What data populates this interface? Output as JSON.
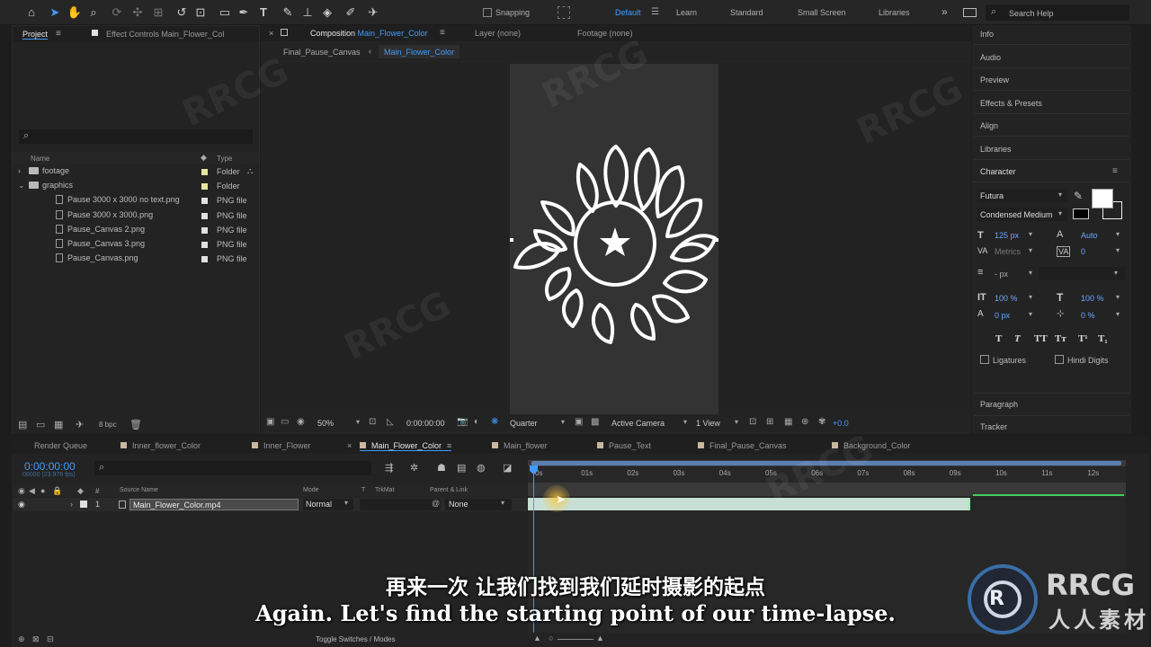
{
  "toolbar": {
    "snapping_label": "Snapping",
    "workspaces": [
      "Default",
      "Learn",
      "Standard",
      "Small Screen",
      "Libraries"
    ],
    "active_workspace": "Default",
    "search_placeholder": "Search Help",
    "tool_icons": [
      "home-icon",
      "selection-icon",
      "hand-icon",
      "zoom-icon",
      "rotate-icon",
      "camera-orbit-icon",
      "pan-behind-icon",
      "rectangle-icon",
      "pen-icon",
      "type-icon",
      "brush-icon",
      "clone-stamp-icon",
      "eraser-icon",
      "roto-brush-icon",
      "puppet-icon"
    ]
  },
  "project_panel": {
    "tab_label": "Project",
    "effect_controls_tab": "Effect Controls Main_Flower_Col",
    "col_name": "Name",
    "col_type": "Type",
    "items": [
      {
        "name": "footage",
        "type": "Folder",
        "kind": "folder",
        "color": "#e6e6a0"
      },
      {
        "name": "graphics",
        "type": "Folder",
        "kind": "folder",
        "color": "#e6e6a0"
      },
      {
        "name": "Pause 3000 x 3000 no text.png",
        "type": "PNG file",
        "kind": "file",
        "color": "#e0e0e0"
      },
      {
        "name": "Pause 3000 x 3000.png",
        "type": "PNG file",
        "kind": "file",
        "color": "#e0e0e0"
      },
      {
        "name": "Pause_Canvas 2.png",
        "type": "PNG file",
        "kind": "file",
        "color": "#e0e0e0"
      },
      {
        "name": "Pause_Canvas 3.png",
        "type": "PNG file",
        "kind": "file",
        "color": "#e0e0e0"
      },
      {
        "name": "Pause_Canvas.png",
        "type": "PNG file",
        "kind": "file",
        "color": "#e0e0e0"
      }
    ],
    "bpc": "8 bpc"
  },
  "composition_panel": {
    "tab_prefix": "Composition",
    "tab_name": "Main_Flower_Color",
    "layer_tab": "Layer (none)",
    "footage_tab": "Footage (none)",
    "breadcrumb": [
      "Final_Pause_Canvas",
      "Main_Flower_Color"
    ],
    "zoom": "50%",
    "timecode": "0:00:00:00",
    "resolution": "Quarter",
    "camera": "Active Camera",
    "views": "1 View",
    "exposure": "+0.0"
  },
  "right_panel": {
    "items": [
      "Info",
      "Audio",
      "Preview",
      "Effects & Presets",
      "Align",
      "Libraries"
    ],
    "character": {
      "title": "Character",
      "font": "Futura",
      "style": "Condensed Medium",
      "size": "125 px",
      "leading": "Auto",
      "kerning": "Metrics",
      "tracking": "0",
      "stroke": "- px",
      "vscale": "100 %",
      "hscale": "100 %",
      "baseline": "0 px",
      "tsume": "0 %",
      "ligatures": "Ligatures",
      "hindi_digits": "Hindi Digits",
      "style_buttons": [
        "T",
        "T",
        "TT",
        "Tт",
        "T¹",
        "T₁"
      ]
    },
    "paragraph": "Paragraph",
    "tracker": "Tracker"
  },
  "timeline": {
    "tabs": [
      {
        "label": "Render Queue",
        "color": null
      },
      {
        "label": "Inner_flower_Color",
        "color": "#c9b8a0"
      },
      {
        "label": "Inner_Flower",
        "color": "#c9b8a0"
      },
      {
        "label": "Main_Flower_Color",
        "color": "#c9b8a0",
        "active": true
      },
      {
        "label": "Main_flower",
        "color": "#c9b8a0"
      },
      {
        "label": "Pause_Text",
        "color": "#c9b8a0"
      },
      {
        "label": "Final_Pause_Canvas",
        "color": "#c9b8a0"
      },
      {
        "label": "Background_Color",
        "color": "#c9b8a0"
      }
    ],
    "current_time": "0:00:00:00",
    "fps": "00000 (23.976 fps)",
    "columns": {
      "source_name": "Source Name",
      "mode": "Mode",
      "t": "T",
      "trkmat": "TrkMat",
      "parent": "Parent & Link"
    },
    "layer": {
      "index": "1",
      "name": "Main_Flower_Color.mp4",
      "mode": "Normal",
      "parent": "None"
    },
    "ruler": [
      "0s",
      "01s",
      "02s",
      "03s",
      "04s",
      "05s",
      "06s",
      "07s",
      "08s",
      "09s",
      "10s",
      "11s",
      "12s"
    ],
    "toggle_label": "Toggle Switches / Modes"
  },
  "subtitles": {
    "cn": "再来一次 让我们找到我们延时摄影的起点",
    "en": "Again. Let's find the starting point of our time-lapse."
  },
  "watermark": {
    "logo_text": "RRCG",
    "logo_sub": "人人素材"
  }
}
